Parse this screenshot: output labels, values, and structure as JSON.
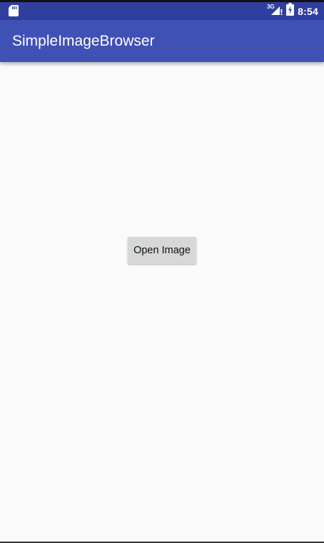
{
  "status_bar": {
    "left_icon": "sd-card-icon",
    "network_label": "3G",
    "signal_icon": "cell-signal-icon",
    "battery_icon": "battery-charging-icon",
    "time": "8:54"
  },
  "app_bar": {
    "title": "SimpleImageBrowser"
  },
  "main": {
    "open_button_label": "Open Image"
  },
  "colors": {
    "status_bar": "#303f9f",
    "app_bar": "#3f51b5",
    "background": "#fafafa",
    "button": "#d6d7d7"
  }
}
